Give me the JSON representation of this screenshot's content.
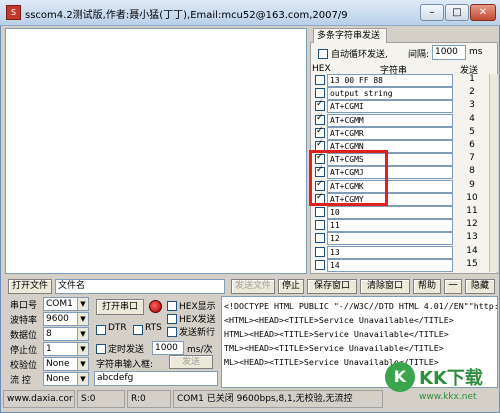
{
  "window": {
    "title": "sscom4.2测试版,作者:聂小猛(丁丁),Email:mcu52@163.com,2007/9",
    "min_label": "–",
    "max_label": "□",
    "close_label": "✕"
  },
  "multi_send": {
    "tab_label": "多条字符串发送",
    "auto_loop_label": "自动循环发送,",
    "interval_label": "间隔:",
    "interval_value": "1000",
    "interval_unit": "ms",
    "col_hex": "HEX",
    "col_string": "字符串",
    "col_send": "发送",
    "rows": [
      {
        "hex": false,
        "text": "13 00 FF 88",
        "num": "1"
      },
      {
        "hex": false,
        "text": "output string",
        "num": "2"
      },
      {
        "hex": true,
        "text": "AT+CGMI",
        "num": "3"
      },
      {
        "hex": true,
        "text": "AT+CGMM",
        "num": "4"
      },
      {
        "hex": true,
        "text": "AT+CGMR",
        "num": "5"
      },
      {
        "hex": true,
        "text": "AT+CGMN",
        "num": "6"
      },
      {
        "hex": true,
        "text": "AT+CGMS",
        "num": "7"
      },
      {
        "hex": true,
        "text": "AT+CGMJ",
        "num": "8"
      },
      {
        "hex": true,
        "text": "AT+CGMK",
        "num": "9"
      },
      {
        "hex": true,
        "text": "AT+CGMY",
        "num": "10"
      },
      {
        "hex": false,
        "text": "10",
        "num": "11"
      },
      {
        "hex": false,
        "text": "11",
        "num": "12"
      },
      {
        "hex": false,
        "text": "12",
        "num": "13"
      },
      {
        "hex": false,
        "text": "13",
        "num": "14"
      },
      {
        "hex": false,
        "text": "14",
        "num": "15"
      }
    ]
  },
  "file_bar": {
    "open_file": "打开文件",
    "file_name": "文件名",
    "send_file": "发送文件",
    "stop": "停止",
    "save_window": "保存窗口",
    "clear_window": "清除窗口",
    "help": "帮助",
    "dash": "一",
    "hide": "隐藏"
  },
  "port": {
    "port_label": "串口号",
    "port_value": "COM1",
    "baud_label": "波特率",
    "baud_value": "9600",
    "data_label": "数据位",
    "data_value": "8",
    "stop_label": "停止位",
    "stop_value": "1",
    "parity_label": "校验位",
    "parity_value": "None",
    "flow_label": "流 控",
    "flow_value": "None",
    "open_button": "打开串口"
  },
  "options": {
    "hex_display": "HEX显示",
    "hex_send": "HEX发送",
    "dtr": "DTR",
    "rts": "RTS",
    "send_newline": "发送新行",
    "timed_send": "定时发送",
    "timed_value": "1000",
    "timed_unit": "ms/次",
    "input_label": "字符串输入框:",
    "send_button": "发送",
    "input_value": "abcdefg"
  },
  "log_lines": [
    "<!DOCTYPE HTML PUBLIC \"-//W3C//DTD HTML 4.01//EN\"\"http:/",
    "<HTML><HEAD><TITLE>Service Unavailable</TITLE>",
    "HTML><HEAD><TITLE>Service Unavailable</TITLE>",
    "TML><HEAD><TITLE>Service Unavailable</TITLE>",
    "ML><HEAD><TITLE>Service Unavailable</TITLE>"
  ],
  "status": {
    "website": "www.daxia.cor",
    "sent": "S:0",
    "received": "R:0",
    "port_info": "COM1 已关闭  9600bps,8,1,无校验,无流控"
  },
  "watermark": {
    "brand": "KK下载",
    "url": "www.kkx.net"
  },
  "colors": {
    "highlight": "#e02020",
    "record_indicator": "#c00000"
  }
}
